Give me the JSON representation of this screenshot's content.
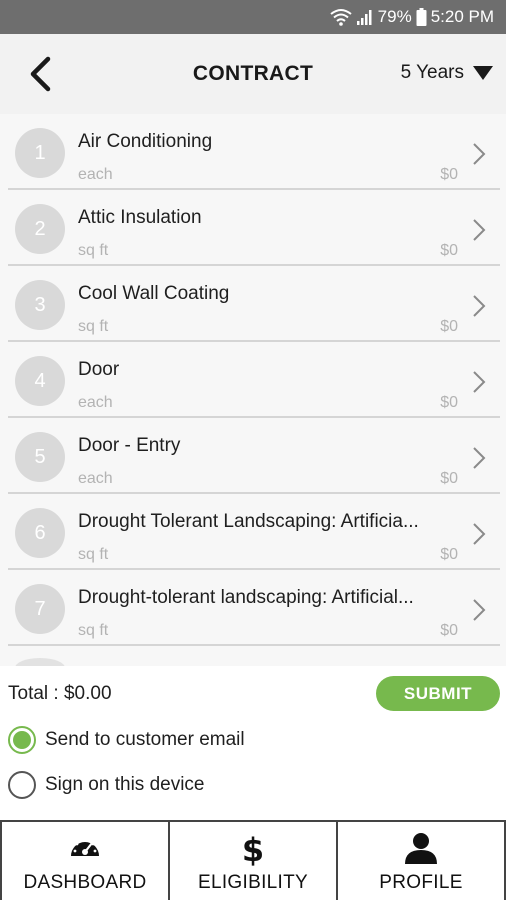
{
  "status_bar": {
    "battery": "79%",
    "time": "5:20 PM",
    "icons": [
      "wifi-icon",
      "signal-icon",
      "battery-icon"
    ]
  },
  "header": {
    "back_icon": "back-arrow-icon",
    "title": "CONTRACT",
    "period": "5 Years",
    "period_icon": "dropdown-triangle-icon"
  },
  "items": [
    {
      "number": "1",
      "name": "Air Conditioning",
      "unit": "each",
      "price": "$0"
    },
    {
      "number": "2",
      "name": "Attic Insulation",
      "unit": "sq ft",
      "price": "$0"
    },
    {
      "number": "3",
      "name": "Cool Wall Coating",
      "unit": "sq ft",
      "price": "$0"
    },
    {
      "number": "4",
      "name": "Door",
      "unit": "each",
      "price": "$0"
    },
    {
      "number": "5",
      "name": "Door - Entry",
      "unit": "each",
      "price": "$0"
    },
    {
      "number": "6",
      "name": "Drought Tolerant Landscaping: Artificia...",
      "unit": "sq ft",
      "price": "$0"
    },
    {
      "number": "7",
      "name": "Drought-tolerant landscaping: Artificial...",
      "unit": "sq ft",
      "price": "$0"
    }
  ],
  "footer": {
    "total": "Total : $0.00",
    "submit_label": "SUBMIT",
    "options": [
      {
        "label": "Send to customer email",
        "checked": true
      },
      {
        "label": "Sign on this device",
        "checked": false
      }
    ]
  },
  "nav": {
    "tabs": [
      {
        "label": "DASHBOARD",
        "icon": "speedometer-icon"
      },
      {
        "label": "ELIGIBILITY",
        "icon": "dollar-icon"
      },
      {
        "label": "PROFILE",
        "icon": "person-icon"
      }
    ]
  },
  "colors": {
    "accent": "#77b94d",
    "status_bar": "#6e6e6e",
    "header_bg": "#f2f2f2",
    "circle": "#d9d9d9"
  }
}
